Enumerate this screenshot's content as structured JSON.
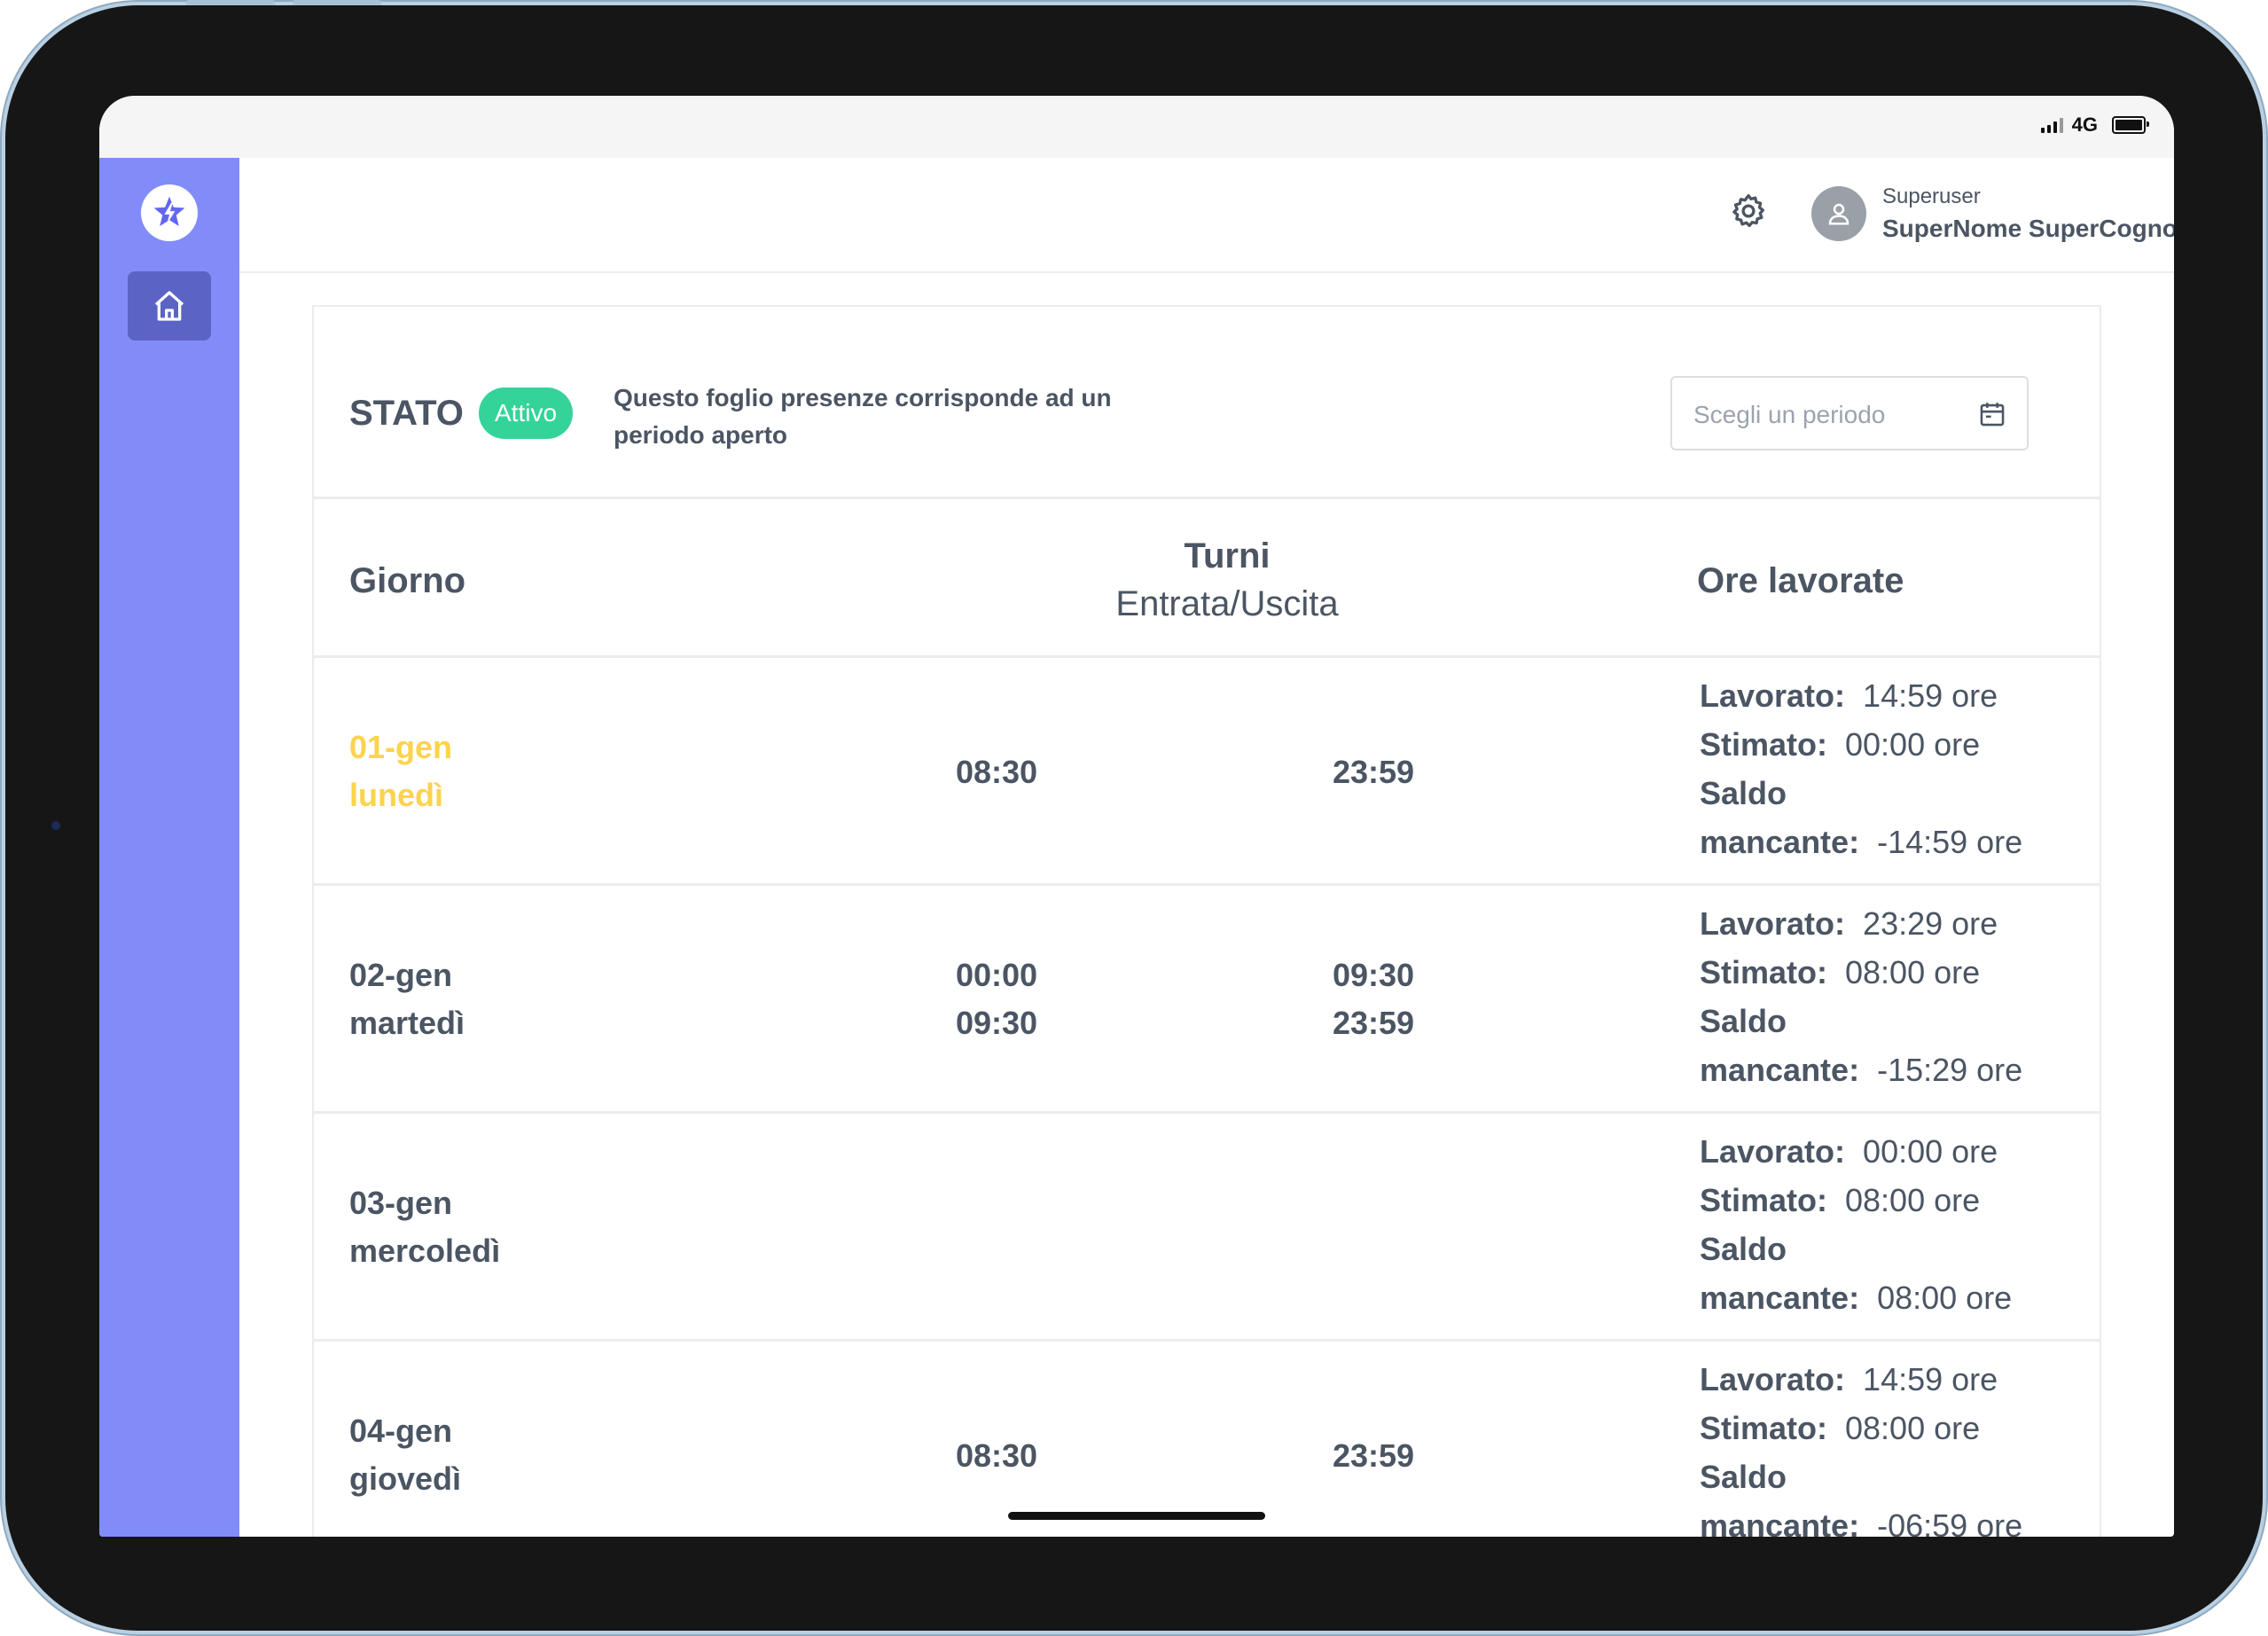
{
  "status_bar": {
    "network": "4G"
  },
  "sidebar": {
    "logo_icon": "star-logo-icon",
    "items": [
      {
        "icon": "home-icon",
        "active": true
      }
    ]
  },
  "header": {
    "settings_icon": "gear-icon",
    "user": {
      "role": "Superuser",
      "name": "SuperNome SuperCognome"
    }
  },
  "stato": {
    "label": "STATO",
    "badge": "Attivo",
    "description": "Questo foglio presenze corrisponde ad un periodo aperto",
    "period_placeholder": "Scegli un periodo"
  },
  "table": {
    "headers": {
      "giorno": "Giorno",
      "turni": "Turni",
      "turni_sub": "Entrata/Uscita",
      "ore": "Ore lavorate"
    },
    "labels": {
      "lavorato": "Lavorato:",
      "stimato": "Stimato:",
      "saldo": "Saldo",
      "mancante": "mancante:"
    },
    "rows": [
      {
        "date": "01-gen",
        "day": "lunedì",
        "in1": "08:30",
        "out1": "23:59",
        "in2": "",
        "out2": "",
        "lavorato": "14:59 ore",
        "stimato": "00:00 ore",
        "mancante": "-14:59 ore"
      },
      {
        "date": "02-gen",
        "day": "martedì",
        "in1": "00:00",
        "out1": "09:30",
        "in2": "09:30",
        "out2": "23:59",
        "lavorato": "23:29 ore",
        "stimato": "08:00 ore",
        "mancante": "-15:29 ore"
      },
      {
        "date": "03-gen",
        "day": "mercoledì",
        "in1": "",
        "out1": "",
        "in2": "",
        "out2": "",
        "lavorato": "00:00 ore",
        "stimato": "08:00 ore",
        "mancante": "08:00 ore"
      },
      {
        "date": "04-gen",
        "day": "giovedì",
        "in1": "08:30",
        "out1": "23:59",
        "in2": "",
        "out2": "",
        "lavorato": "14:59 ore",
        "stimato": "08:00 ore",
        "mancante": "-06:59 ore"
      }
    ]
  },
  "colors": {
    "sidebar": "#818cf8",
    "active_nav": "#5b64c4",
    "badge": "#34d399",
    "today": "#fcd34d",
    "text": "#4b5563"
  }
}
